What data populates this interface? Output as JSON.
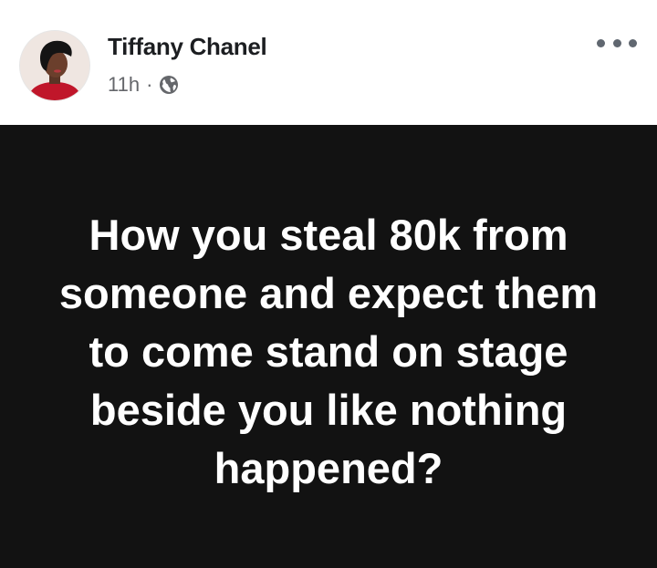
{
  "author": {
    "name": "Tiffany Chanel",
    "avatar_icon": "profile-photo"
  },
  "meta": {
    "time": "11h",
    "separator": "·",
    "audience_icon": "globe-icon"
  },
  "menu": {
    "icon": "more-options-icon"
  },
  "post": {
    "text": "How you steal 80k from someone and expect them to come stand on stage beside you like nothing happened?",
    "background_color": "#121212",
    "text_color": "#ffffff"
  }
}
